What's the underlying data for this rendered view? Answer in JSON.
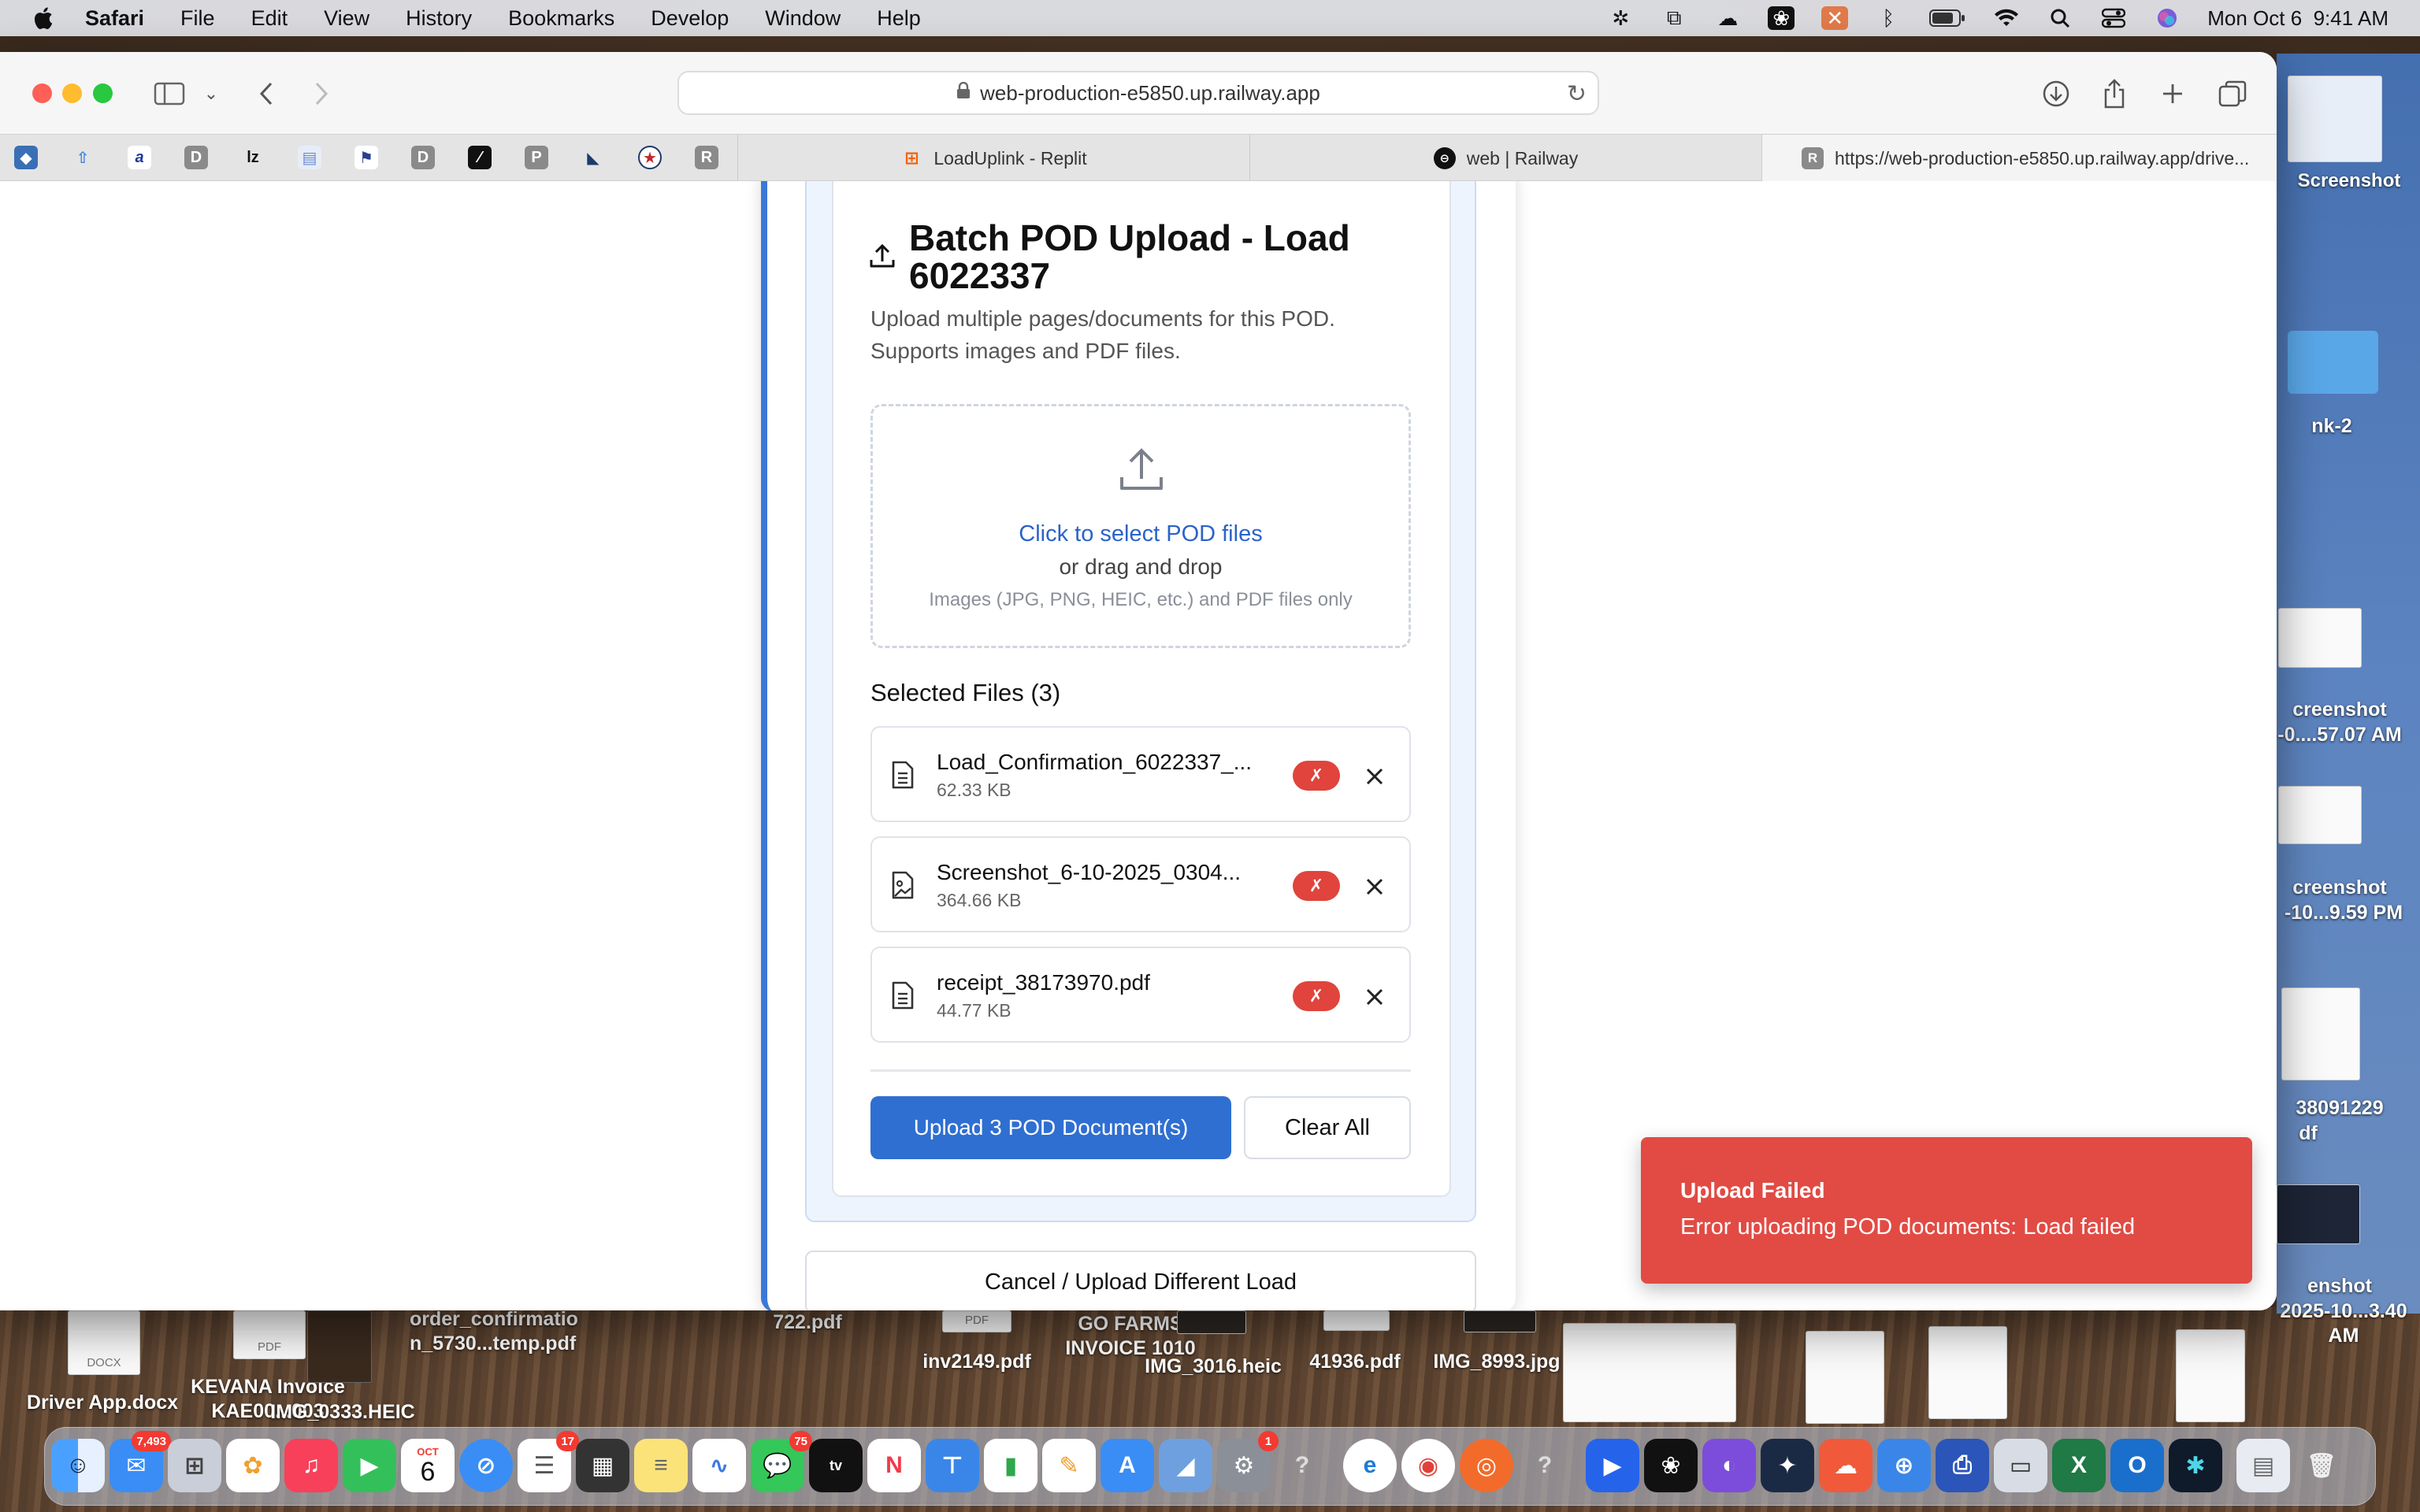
{
  "menubar": {
    "app_name": "Safari",
    "menus": [
      "File",
      "Edit",
      "View",
      "History",
      "Bookmarks",
      "Develop",
      "Window",
      "Help"
    ],
    "clock": "Mon Oct 6  9:41 AM"
  },
  "browser": {
    "address": "web-production-e5850.up.railway.app",
    "tabs": [
      {
        "label": "LoadUplink - Replit",
        "icon": "replit-icon"
      },
      {
        "label": "web | Railway",
        "icon": "railway-icon"
      },
      {
        "label": "https://web-production-e5850.up.railway.app/drive...",
        "icon": "railway-r-icon"
      }
    ],
    "pinned_favicons": [
      "diamond",
      "rocket",
      "a",
      "D",
      "lz",
      "doc",
      "flag",
      "D",
      "slash",
      "P",
      "sail",
      "star",
      "R"
    ]
  },
  "batch": {
    "title": "Batch POD Upload - Load 6022337",
    "description": "Upload multiple pages/documents for this POD. Supports images and PDF files.",
    "dropzone": {
      "click_text": "Click to select POD files",
      "drag_text": "or drag and drop",
      "hint": "Images (JPG, PNG, HEIC, etc.) and PDF files only"
    },
    "selected_title": "Selected Files (3)",
    "files": [
      {
        "name": "Load_Confirmation_6022337_...",
        "size": "62.33 KB",
        "status": "✗",
        "icon": "file-text-icon"
      },
      {
        "name": "Screenshot_6-10-2025_0304...",
        "size": "364.66 KB",
        "status": "✗",
        "icon": "file-image-icon"
      },
      {
        "name": "receipt_38173970.pdf",
        "size": "44.77 KB",
        "status": "✗",
        "icon": "file-text-icon"
      }
    ],
    "upload_label": "Upload 3 POD Document(s)",
    "clear_label": "Clear All",
    "cancel_label": "Cancel / Upload Different Load"
  },
  "toast": {
    "title": "Upload Failed",
    "message": "Error uploading POD documents: Load failed"
  },
  "desktop": {
    "right_labels": [
      "Screenshot",
      "creenshot",
      "nk-2",
      "creenshot",
      "-0....57.07 AM",
      "creenshot",
      "-10...9.59 PM",
      "38091229",
      "df",
      "enshot",
      "2025-10...3.40 AM"
    ],
    "bottom_files": [
      {
        "label": "Driver App.docx",
        "badge": "DOCX"
      },
      {
        "label": "KEVANA Invoice KAE00...003",
        "badge": "PDF"
      },
      {
        "label": "IMG_0333.HEIC",
        "badge": ""
      },
      {
        "label": "order_confirmatio n_5730...temp.pdf",
        "badge": ""
      },
      {
        "label": "722.pdf",
        "badge": ""
      },
      {
        "label": "inv2149.pdf",
        "badge": "PDF"
      },
      {
        "label": "GO FARMS INVOICE 1010",
        "badge": ""
      },
      {
        "label": "IMG_3016.heic",
        "badge": ""
      },
      {
        "label": "41936.pdf",
        "badge": ""
      },
      {
        "label": "IMG_8993.jpg",
        "badge": ""
      }
    ]
  },
  "dock": {
    "badges": {
      "mail": "7,493",
      "reminders": "17",
      "messages": "75",
      "settings": "1"
    },
    "calendar_month": "OCT",
    "calendar_day": "6"
  },
  "colors": {
    "accent": "#2f6fd1",
    "error": "#e14b44",
    "link": "#2a63c9"
  }
}
